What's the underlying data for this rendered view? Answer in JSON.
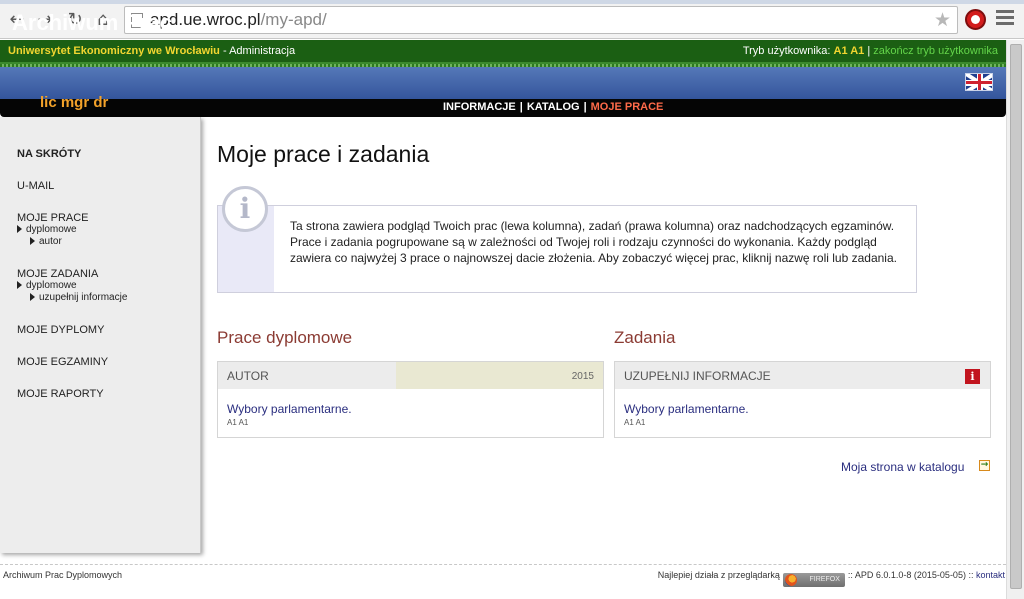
{
  "browser": {
    "url_host": "apd.ue.wroc.pl",
    "url_path": "/my-apd/",
    "icons": [
      "back-icon",
      "forward-icon",
      "reload-icon",
      "home-icon",
      "page-icon",
      "star-icon",
      "extension-icon",
      "menu-icon"
    ]
  },
  "topbar": {
    "university": "Uniwersytet Ekonomiczny we Wrocławiu",
    "separator": " - ",
    "admin": "Administracja",
    "mode_label": "Tryb użytkownika: ",
    "mode_user": "A1 A1",
    "pipe": " | ",
    "end_mode": "zakończ tryb użytkownika"
  },
  "header": {
    "site_title": "Archiwum Prac",
    "user_role": "lic mgr dr",
    "flag_icon": "uk-flag-icon"
  },
  "menu": {
    "items": [
      "INFORMACJE",
      "KATALOG",
      "MOJE PRACE"
    ],
    "separator": "|",
    "active_index": 2
  },
  "sidebar": {
    "shortcuts": "NA SKRÓTY",
    "umail": "U-MAIL",
    "my_works": "MOJE PRACE",
    "my_works_sub": "dyplomowe",
    "my_works_sub2": "autor",
    "my_tasks": "MOJE ZADANIA",
    "my_tasks_sub": "dyplomowe",
    "my_tasks_sub2": "uzupełnij informacje",
    "my_diplomas": "MOJE DYPLOMY",
    "my_exams": "MOJE EGZAMINY",
    "my_reports": "MOJE RAPORTY"
  },
  "main": {
    "page_title": "Moje prace i zadania",
    "info_icon": "i",
    "info_text": "Ta strona zawiera podgląd Twoich prac (lewa kolumna), zadań (prawa kolumna) oraz nadchodzących egzaminów. Prace i zadania pogrupowane są w zależności od Twojej roli i rodzaju czynności do wykonania. Każdy podgląd zawiera co najwyżej 3 prace o najnowszej dacie złożenia. Aby zobaczyć więcej prac, kliknij nazwę roli lub zadania.",
    "works": {
      "title": "Prace dyplomowe",
      "role": "AUTOR",
      "year": "2015",
      "item_title": "Wybory parlamentarne.",
      "item_author": "A1 A1"
    },
    "tasks": {
      "title": "Zadania",
      "role": "UZUPEŁNIJ INFORMACJE",
      "badge": "i",
      "item_title": "Wybory parlamentarne.",
      "item_author": "A1 A1"
    },
    "catalog_link": "Moja strona w katalogu"
  },
  "footer": {
    "left": "Archiwum Prac Dyplomowych",
    "works_best": "Najlepiej działa z przeglądarką",
    "firefox": "FIREFOX",
    "version": ":: APD 6.0.1.0-8 (2015-05-05) ::",
    "contact": "kontakt"
  }
}
